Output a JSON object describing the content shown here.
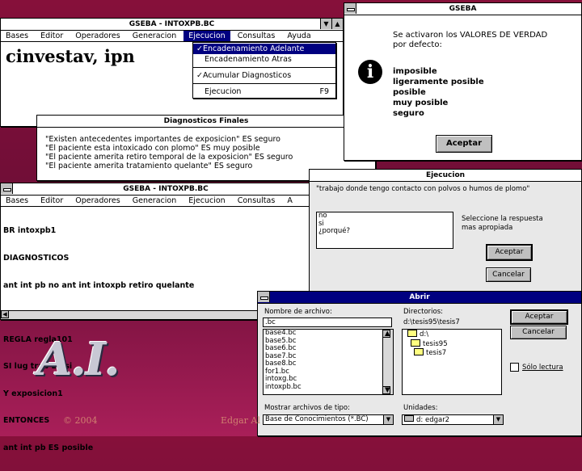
{
  "win1": {
    "title": "GSEBA - INTOXPB.BC",
    "menu": [
      "Bases",
      "Editor",
      "Operadores",
      "Generacion",
      "Ejecucion",
      "Consultas",
      "Ayuda"
    ],
    "content": "cinvestav, ipn"
  },
  "dropdown": {
    "items": [
      {
        "label": "Encadenamiento Adelante",
        "check": "✓",
        "shortcut": ""
      },
      {
        "label": "Encadenamiento Atras",
        "check": "",
        "shortcut": ""
      },
      {
        "label": "Acumular Diagnosticos",
        "check": "✓",
        "shortcut": ""
      },
      {
        "label": "Ejecucion",
        "check": "",
        "shortcut": "F9"
      }
    ]
  },
  "msgbox": {
    "title": "GSEBA",
    "message_line1": "Se activaron los VALORES DE VERDAD",
    "message_line2": "por defecto:",
    "values": [
      "imposible",
      "ligeramente posible",
      "posible",
      "muy posible",
      "seguro"
    ],
    "button": "Aceptar",
    "icon": "info-icon"
  },
  "diag": {
    "title": "Diagnosticos Finales",
    "lines": [
      "\"Existen antecedentes importantes de exposicion\" ES seguro",
      "\"El paciente esta intoxicado con plomo\" ES muy posible",
      "\"El paciente amerita retiro temporal de la exposicion\" ES seguro",
      "\"El paciente amerita tratamiento quelante\" ES seguro"
    ]
  },
  "editor": {
    "title": "GSEBA - INTOXPB.BC",
    "menu": [
      "Bases",
      "Editor",
      "Operadores",
      "Generacion",
      "Ejecucion",
      "Consultas",
      "A"
    ],
    "lines": [
      "BR intoxpb1",
      "DIAGNOSTICOS",
      "ant int pb no ant int intoxpb retiro quelante",
      "",
      "REGLA regla101",
      "SI lug trab ES si",
      "Y exposicion1",
      "ENTONCES",
      "ant int pb ES posible"
    ]
  },
  "ejec": {
    "title": "Ejecucion",
    "question": "\"trabajo donde tengo contacto con polvos o humos de plomo\"",
    "options": [
      "no",
      "si",
      "¿porqué?"
    ],
    "prompt_line1": "Seleccione la respuesta",
    "prompt_line2": "mas apropiada",
    "ok": "Aceptar",
    "cancel": "Cancelar"
  },
  "abrir": {
    "title": "Abrir",
    "file_label": "Nombre de archivo:",
    "file_value": ".bc",
    "files": [
      "base4.bc",
      "base5.bc",
      "base6.bc",
      "base7.bc",
      "base8.bc",
      "for1.bc",
      "intoxg.bc",
      "intoxpb.bc"
    ],
    "dir_label": "Directorios:",
    "dir_path": "d:\\tesis95\\tesis7",
    "dirs": [
      "d:\\",
      "tesis95",
      "tesis7"
    ],
    "ok": "Aceptar",
    "cancel": "Cancelar",
    "readonly": "Sólo lectura",
    "type_label": "Mostrar archivos de tipo:",
    "type_value": "Base de Conocimientos (*.BC)",
    "drive_label": "Unidades:",
    "drive_value": "d: edgar2"
  },
  "footer": {
    "logo": "A.I.",
    "copyright": "© 2004",
    "author": "Edgar Al"
  },
  "colors": {
    "background": "#86103a",
    "selection": "#000080",
    "footer_text": "#d08070"
  }
}
